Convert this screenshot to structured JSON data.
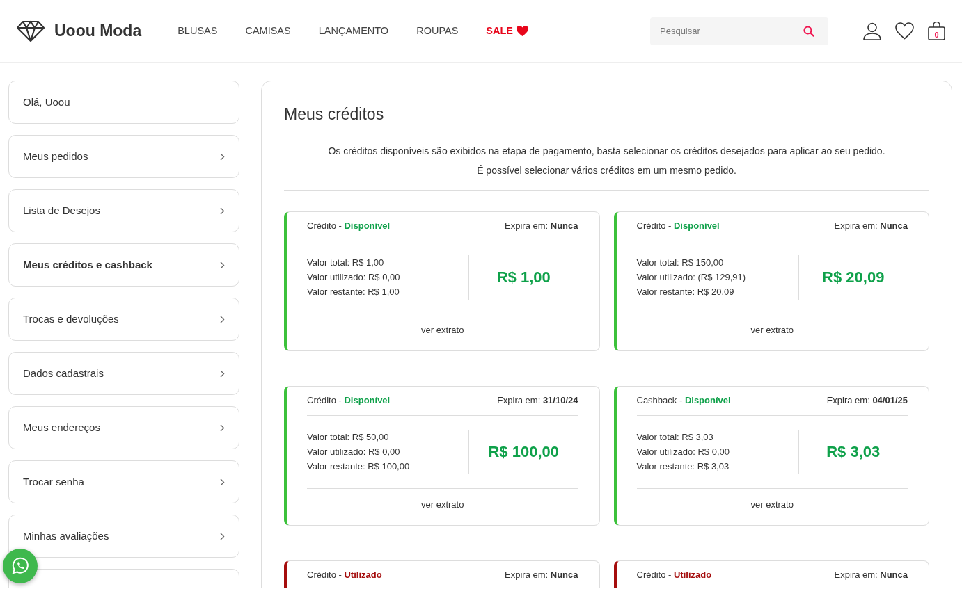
{
  "brand": {
    "name": "Uoou Moda"
  },
  "nav": [
    {
      "label": "BLUSAS",
      "kind": "normal"
    },
    {
      "label": "CAMISAS",
      "kind": "normal"
    },
    {
      "label": "LANÇAMENTO",
      "kind": "normal"
    },
    {
      "label": "ROUPAS",
      "kind": "normal"
    },
    {
      "label": "SALE",
      "kind": "sale"
    }
  ],
  "search": {
    "placeholder": "Pesquisar"
  },
  "cart": {
    "count": "0"
  },
  "sidebar": {
    "items": [
      {
        "label": "Olá, Uoou",
        "kind": "greeting",
        "selected": false
      },
      {
        "label": "Meus pedidos",
        "kind": "link",
        "selected": false
      },
      {
        "label": "Lista de Desejos",
        "kind": "link",
        "selected": false
      },
      {
        "label": "Meus créditos e cashback",
        "kind": "link",
        "selected": true
      },
      {
        "label": "Trocas e devoluções",
        "kind": "link",
        "selected": false
      },
      {
        "label": "Dados cadastrais",
        "kind": "link",
        "selected": false
      },
      {
        "label": "Meus endereços",
        "kind": "link",
        "selected": false
      },
      {
        "label": "Trocar senha",
        "kind": "link",
        "selected": false
      },
      {
        "label": "Minhas avaliações",
        "kind": "link",
        "selected": false
      },
      {
        "kind": "cut"
      }
    ]
  },
  "main": {
    "title": "Meus créditos",
    "info": [
      "Os créditos disponíveis são exibidos na etapa de pagamento, basta selecionar os créditos desejados para aplicar ao seu pedido.",
      "É possível selecionar vários créditos em um mesmo pedido."
    ]
  },
  "credits": [
    {
      "type": "Crédito -",
      "status": "Disponível",
      "kind": "available",
      "expires_label": "Expira em:",
      "expires": "Nunca",
      "lines": [
        "Valor total: R$ 1,00",
        "Valor utilizado: R$ 0,00",
        "Valor restante: R$ 1,00"
      ],
      "amount": "R$ 1,00",
      "link": "ver extrato"
    },
    {
      "type": "Crédito -",
      "status": "Disponível",
      "kind": "available",
      "expires_label": "Expira em:",
      "expires": "Nunca",
      "lines": [
        "Valor total: R$ 150,00",
        "Valor utilizado: (R$ 129,91)",
        "Valor restante: R$ 20,09"
      ],
      "amount": "R$ 20,09",
      "link": "ver extrato"
    },
    {
      "type": "Crédito -",
      "status": "Disponível",
      "kind": "available",
      "expires_label": "Expira em:",
      "expires": "31/10/24",
      "lines": [
        "Valor total: R$ 50,00",
        "Valor utilizado: R$ 0,00",
        "Valor restante: R$ 100,00"
      ],
      "amount": "R$ 100,00",
      "link": "ver extrato"
    },
    {
      "type": "Cashback -",
      "status": "Disponível",
      "kind": "available",
      "expires_label": "Expira em:",
      "expires": "04/01/25",
      "lines": [
        "Valor total: R$ 3,03",
        "Valor utilizado: R$ 0,00",
        "Valor restante: R$ 3,03"
      ],
      "amount": "R$ 3,03",
      "link": "ver extrato"
    },
    {
      "type": "Crédito -",
      "status": "Utilizado",
      "kind": "used",
      "expires_label": "Expira em:",
      "expires": "Nunca"
    },
    {
      "type": "Crédito -",
      "status": "Utilizado",
      "kind": "used",
      "expires_label": "Expira em:",
      "expires": "Nunca"
    }
  ]
}
